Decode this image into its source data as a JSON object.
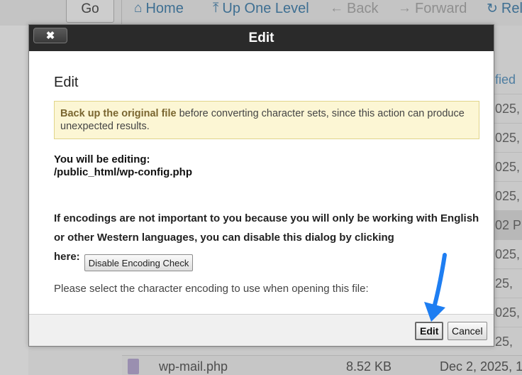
{
  "toolbar": {
    "go_label": "Go",
    "home_label": "Home",
    "up_label": "Up One Level",
    "back_label": "Back",
    "forward_label": "Forward",
    "reload_label": "Rel"
  },
  "file_list": {
    "column_header": "fied",
    "dates": [
      "025,",
      "025,",
      "025,",
      "025,",
      "25,",
      "02 PM",
      "025,",
      "25,",
      "025,",
      "25,"
    ],
    "bottom_row": {
      "name": "wp-mail.php",
      "size": "8.52 KB",
      "date": "Dec 2, 2025, 1"
    }
  },
  "modal": {
    "title": "Edit",
    "close_label": "✖",
    "heading": "Edit",
    "warning_bold": "Back up the original file",
    "warning_rest": " before converting character sets, since this action can produce unexpected results.",
    "editing_label": "You will be editing:",
    "editing_path": "/public_html/wp-config.php",
    "encoding_text": "If encodings are not important to you because you will only be working with English or other Western languages, you can disable this dialog by clicking",
    "here_label": "here:",
    "disable_button": "Disable Encoding Check",
    "cut_text": "Please select the character encoding to use when opening this file:",
    "edit_button": "Edit",
    "cancel_button": "Cancel"
  },
  "colors": {
    "header_bg": "#2a2a2a",
    "warning_bg": "#fcf6d4",
    "arrow": "#1e7ef2"
  }
}
